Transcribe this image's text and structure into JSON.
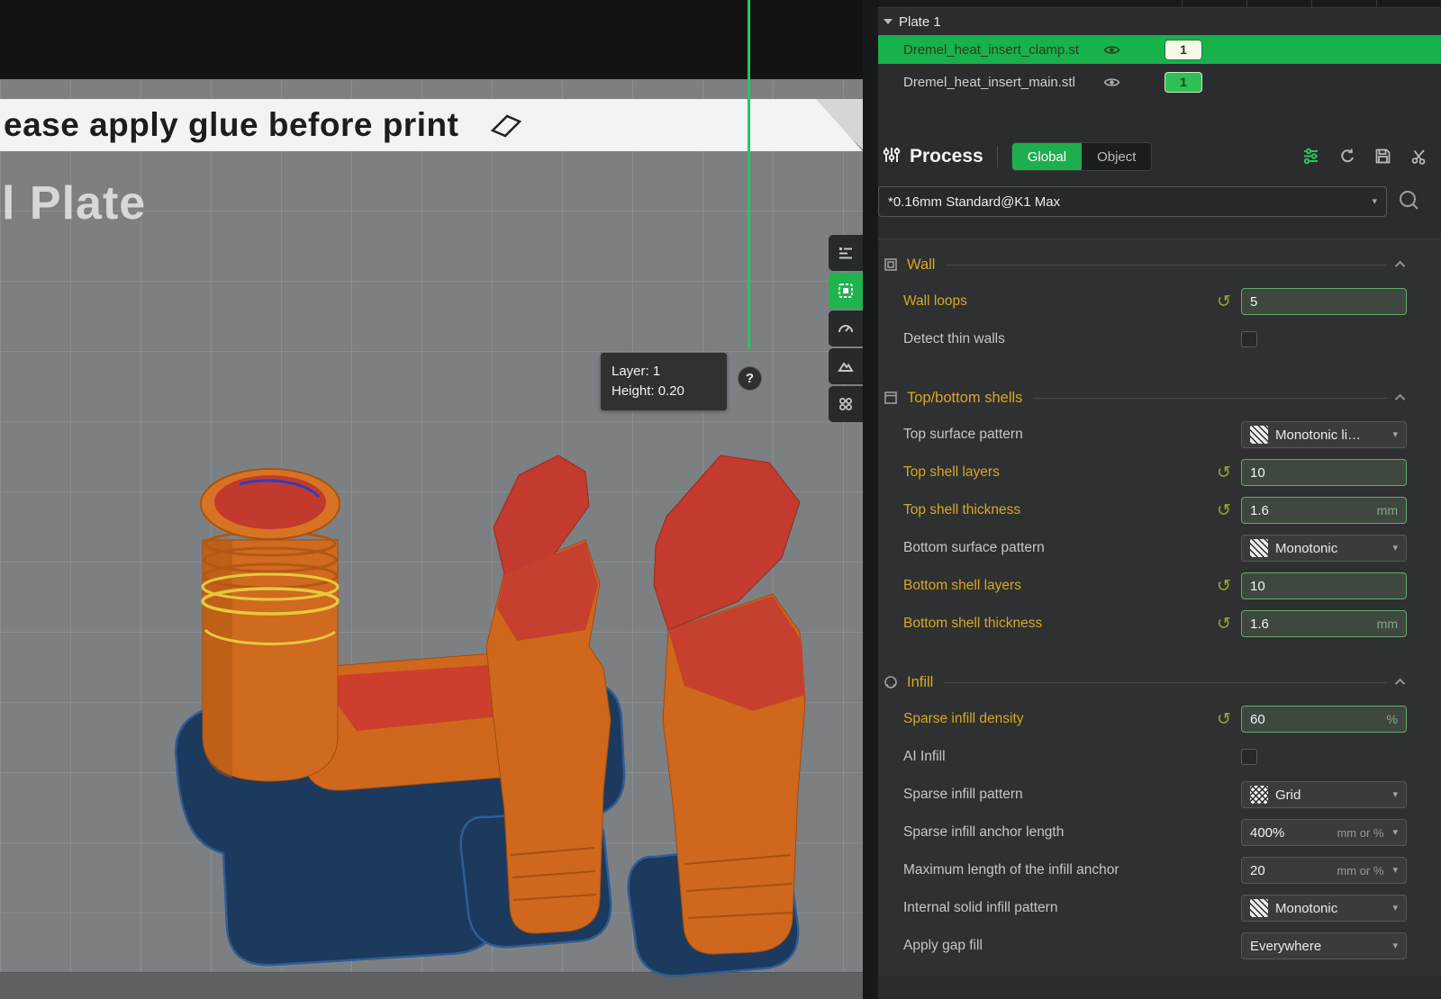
{
  "colors": {
    "accent_green": "#1fae4e",
    "selected_row_green": "#17b24b",
    "modified_yellow": "#d9a81c",
    "field_border_green": "#61a96b",
    "brim_blue": "#1c3a5e",
    "model_orange": "#cf671c",
    "model_red": "#c33a2e"
  },
  "viewport": {
    "banner": {
      "text": "ease apply glue before print"
    },
    "plate_label": "l Plate",
    "layer_slider": {
      "tooltip_layer": "Layer: 1",
      "tooltip_height": "Height: 0.20",
      "help": "?"
    }
  },
  "object_list": {
    "plate_label": "Plate 1",
    "items": [
      {
        "name": "Dremel_heat_insert_clamp.st",
        "count": "1"
      },
      {
        "name": "Dremel_heat_insert_main.stl",
        "count": "1"
      }
    ]
  },
  "process": {
    "title": "Process",
    "tab_global": "Global",
    "tab_object": "Object",
    "preset": "*0.16mm Standard@K1 Max"
  },
  "sections": {
    "wall": {
      "title": "Wall",
      "wall_loops": {
        "label": "Wall loops",
        "value": "5"
      },
      "detect_thin_walls": {
        "label": "Detect thin walls"
      }
    },
    "shells": {
      "title": "Top/bottom shells",
      "top_surface_pattern": {
        "label": "Top surface pattern",
        "value": "Monotonic li…"
      },
      "top_shell_layers": {
        "label": "Top shell layers",
        "value": "10"
      },
      "top_shell_thickness": {
        "label": "Top shell thickness",
        "value": "1.6",
        "unit": "mm"
      },
      "bottom_surface_pattern": {
        "label": "Bottom surface pattern",
        "value": "Monotonic"
      },
      "bottom_shell_layers": {
        "label": "Bottom shell layers",
        "value": "10"
      },
      "bottom_shell_thickness": {
        "label": "Bottom shell thickness",
        "value": "1.6",
        "unit": "mm"
      }
    },
    "infill": {
      "title": "Infill",
      "sparse_infill_density": {
        "label": "Sparse infill density",
        "value": "60",
        "unit": "%"
      },
      "ai_infill": {
        "label": "AI Infill"
      },
      "sparse_infill_pattern": {
        "label": "Sparse infill pattern",
        "value": "Grid"
      },
      "sparse_infill_anchor_length": {
        "label": "Sparse infill anchor length",
        "value": "400%",
        "unit": "mm or %"
      },
      "max_infill_anchor": {
        "label": "Maximum length of the infill anchor",
        "value": "20",
        "unit": "mm or %"
      },
      "internal_solid_infill_pattern": {
        "label": "Internal solid infill pattern",
        "value": "Monotonic"
      },
      "apply_gap_fill": {
        "label": "Apply gap fill",
        "value": "Everywhere"
      }
    }
  }
}
